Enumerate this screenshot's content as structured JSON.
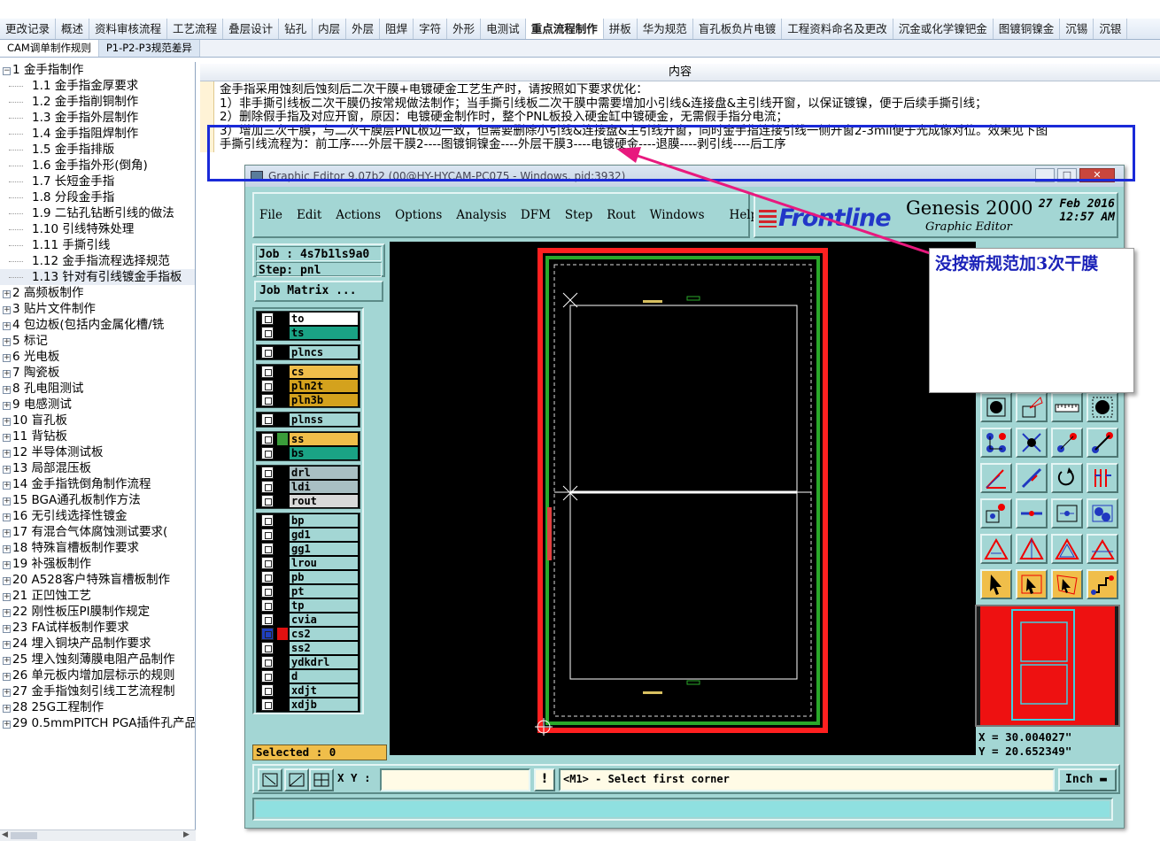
{
  "tabs_row1": [
    "更改记录",
    "概述",
    "资料审核流程",
    "工艺流程",
    "叠层设计",
    "钻孔",
    "内层",
    "外层",
    "阻焊",
    "字符",
    "外形",
    "电测试",
    "重点流程制作",
    "拼板",
    "华为规范",
    "盲孔板负片电镀",
    "工程资料命名及更改",
    "沉金或化学镍钯金",
    "图镀铜镍金",
    "沉锡",
    "沉银"
  ],
  "active_tab_row1": "重点流程制作",
  "tabs_row2": [
    "CAM调单制作规则",
    "P1-P2-P3规范差异"
  ],
  "tree": {
    "items": [
      {
        "label": "1 金手指制作",
        "sign": "−"
      },
      {
        "label": "1.1 金手指金厚要求",
        "child": true
      },
      {
        "label": "1.2 金手指削铜制作",
        "child": true
      },
      {
        "label": "1.3 金手指外层制作",
        "child": true
      },
      {
        "label": "1.4 金手指阻焊制作",
        "child": true
      },
      {
        "label": "1.5 金手指排版",
        "child": true
      },
      {
        "label": "1.6 金手指外形(倒角)",
        "child": true
      },
      {
        "label": "1.7 长短金手指",
        "child": true
      },
      {
        "label": "1.8 分段金手指",
        "child": true
      },
      {
        "label": "1.9 二钻孔钻断引线的做法",
        "child": true
      },
      {
        "label": "1.10 引线特殊处理",
        "child": true
      },
      {
        "label": "1.11 手撕引线",
        "child": true
      },
      {
        "label": "1.12 金手指流程选择规范",
        "child": true
      },
      {
        "label": "1.13 针对有引线镀金手指板",
        "child": true,
        "selected": true
      },
      {
        "label": "2 高频板制作",
        "sign": "+"
      },
      {
        "label": "3 贴片文件制作",
        "sign": "+"
      },
      {
        "label": "4 包边板(包括内金属化槽/铣",
        "sign": "+"
      },
      {
        "label": "5 标记",
        "sign": "+"
      },
      {
        "label": "6 光电板",
        "sign": "+"
      },
      {
        "label": "7 陶瓷板",
        "sign": "+"
      },
      {
        "label": "8 孔电阻测试",
        "sign": "+"
      },
      {
        "label": "9 电感测试",
        "sign": "+"
      },
      {
        "label": "10 盲孔板",
        "sign": "+"
      },
      {
        "label": "11 背钻板",
        "sign": "+"
      },
      {
        "label": "12 半导体测试板",
        "sign": "+"
      },
      {
        "label": "13 局部混压板",
        "sign": "+"
      },
      {
        "label": "14 金手指铣倒角制作流程",
        "sign": "+"
      },
      {
        "label": "15 BGA通孔板制作方法",
        "sign": "+"
      },
      {
        "label": "16 无引线选择性镀金",
        "sign": "+"
      },
      {
        "label": "17 有混合气体腐蚀测试要求(",
        "sign": "+"
      },
      {
        "label": "18 特殊盲槽板制作要求",
        "sign": "+"
      },
      {
        "label": "19 补强板制作",
        "sign": "+"
      },
      {
        "label": "20 A528客户特殊盲槽板制作",
        "sign": "+"
      },
      {
        "label": "21 正凹蚀工艺",
        "sign": "+"
      },
      {
        "label": "22 刚性板压PI膜制作规定",
        "sign": "+"
      },
      {
        "label": "23 FA试样板制作要求",
        "sign": "+"
      },
      {
        "label": "24 埋入铜块产品制作要求",
        "sign": "+"
      },
      {
        "label": "25 埋入蚀刻薄膜电阻产品制作",
        "sign": "+"
      },
      {
        "label": "26 单元板内增加层标示的规则",
        "sign": "+"
      },
      {
        "label": "27 金手指蚀刻引线工艺流程制",
        "sign": "+"
      },
      {
        "label": "28 25G工程制作",
        "sign": "+"
      },
      {
        "label": "29 0.5mmPITCH PGA插件孔产品",
        "sign": "+"
      }
    ]
  },
  "content": {
    "header": "内容",
    "lines": [
      "金手指采用蚀刻后蚀刻后二次干膜+电镀硬金工艺生产时，请按照如下要求优化：",
      "1）非手撕引线板二次干膜仍按常规做法制作；当手撕引线板二次干膜中需要增加小引线&连接盘&主引线开窗，以保证镀镍，便于后续手撕引线；",
      "2）删除假手指及对应开窗，原因：电镀硬金制作时，整个PNL板投入硬金缸中镀硬金，无需假手指分电流；",
      "3）增加三次干膜，与二次干膜层PNL板边一致，但需要删除小引线&连接盘&主引线开窗，同时金手指连接引线一侧开窗2-3mil便于光成像对位。效果见下图",
      "手撕引线流程为：前工序----外层干膜2----图镀铜镍金----外层干膜3----电镀硬金----退膜----剥引线----后工序"
    ]
  },
  "genesis": {
    "title": "Graphic Editor 9.07b2 (00@HY-HYCAM-PC075 - Windows, pid:3932)",
    "win_buttons": [
      "_",
      "□",
      "✕"
    ],
    "menu": [
      "File",
      "Edit",
      "Actions",
      "Options",
      "Analysis",
      "DFM",
      "Step",
      "Rout",
      "Windows",
      "Help"
    ],
    "brand": {
      "logo": "Frontline",
      "product": "Genesis 2000",
      "subtitle": "Graphic Editor",
      "date": "27 Feb 2016",
      "time": "12:57 AM"
    },
    "job": "Job : 4s7b1ls9a0",
    "step": "Step: pnl",
    "job_matrix": "Job Matrix ...",
    "layers": [
      [
        {
          "name": "to",
          "color": "#ffffff"
        },
        {
          "name": "ts",
          "color": "#1aa385"
        }
      ],
      [
        {
          "name": "plncs",
          "color": "#a3d6d4"
        }
      ],
      [
        {
          "name": "cs",
          "color": "#f0be4a"
        },
        {
          "name": "pln2t",
          "color": "#d4a21d"
        },
        {
          "name": "pln3b",
          "color": "#d4a21d"
        }
      ],
      [
        {
          "name": "plnss",
          "color": "#a3d6d4"
        }
      ],
      [
        {
          "name": "ss",
          "color": "#f0be4a",
          "swatch": "#3a9c3a"
        },
        {
          "name": "bs",
          "color": "#1aa385"
        }
      ],
      [
        {
          "name": "drl",
          "color": "#a9bfc3"
        },
        {
          "name": "ldi",
          "color": "#a9bfc3"
        },
        {
          "name": "rout",
          "color": "#d9d9d9"
        }
      ],
      [
        {
          "name": "bp",
          "color": "#a3d6d4"
        },
        {
          "name": "gd1",
          "color": "#a3d6d4"
        },
        {
          "name": "gg1",
          "color": "#a3d6d4"
        },
        {
          "name": "lrou",
          "color": "#a3d6d4"
        },
        {
          "name": "pb",
          "color": "#a3d6d4"
        },
        {
          "name": "pt",
          "color": "#a3d6d4"
        },
        {
          "name": "tp",
          "color": "#a3d6d4"
        },
        {
          "name": "cvia",
          "color": "#a3d6d4"
        },
        {
          "name": "cs2",
          "color": "#a3d6d4",
          "swatch": "#e01010",
          "active": true
        },
        {
          "name": "ss2",
          "color": "#a3d6d4"
        },
        {
          "name": "ydkdrl",
          "color": "#a3d6d4"
        },
        {
          "name": "d",
          "color": "#a3d6d4"
        },
        {
          "name": "xdjt",
          "color": "#a3d6d4"
        },
        {
          "name": "xdjb",
          "color": "#a3d6d4"
        }
      ]
    ],
    "selected": "Selected : 0",
    "coords": {
      "x": "X = 30.004027\"",
      "y": "Y = 20.652349\""
    },
    "xy_label": "X Y :",
    "xy_value": "",
    "bang": "!",
    "prompt": "<M1> - Select first corner",
    "units": "Inch ▬"
  },
  "callout": "没按新规范加3次干膜",
  "colors": {
    "accent_box": "#1a2ad8",
    "arrow": "#e8197e",
    "callout_text": "#1b22b8",
    "genesis_bg": "#a3d6d4"
  }
}
